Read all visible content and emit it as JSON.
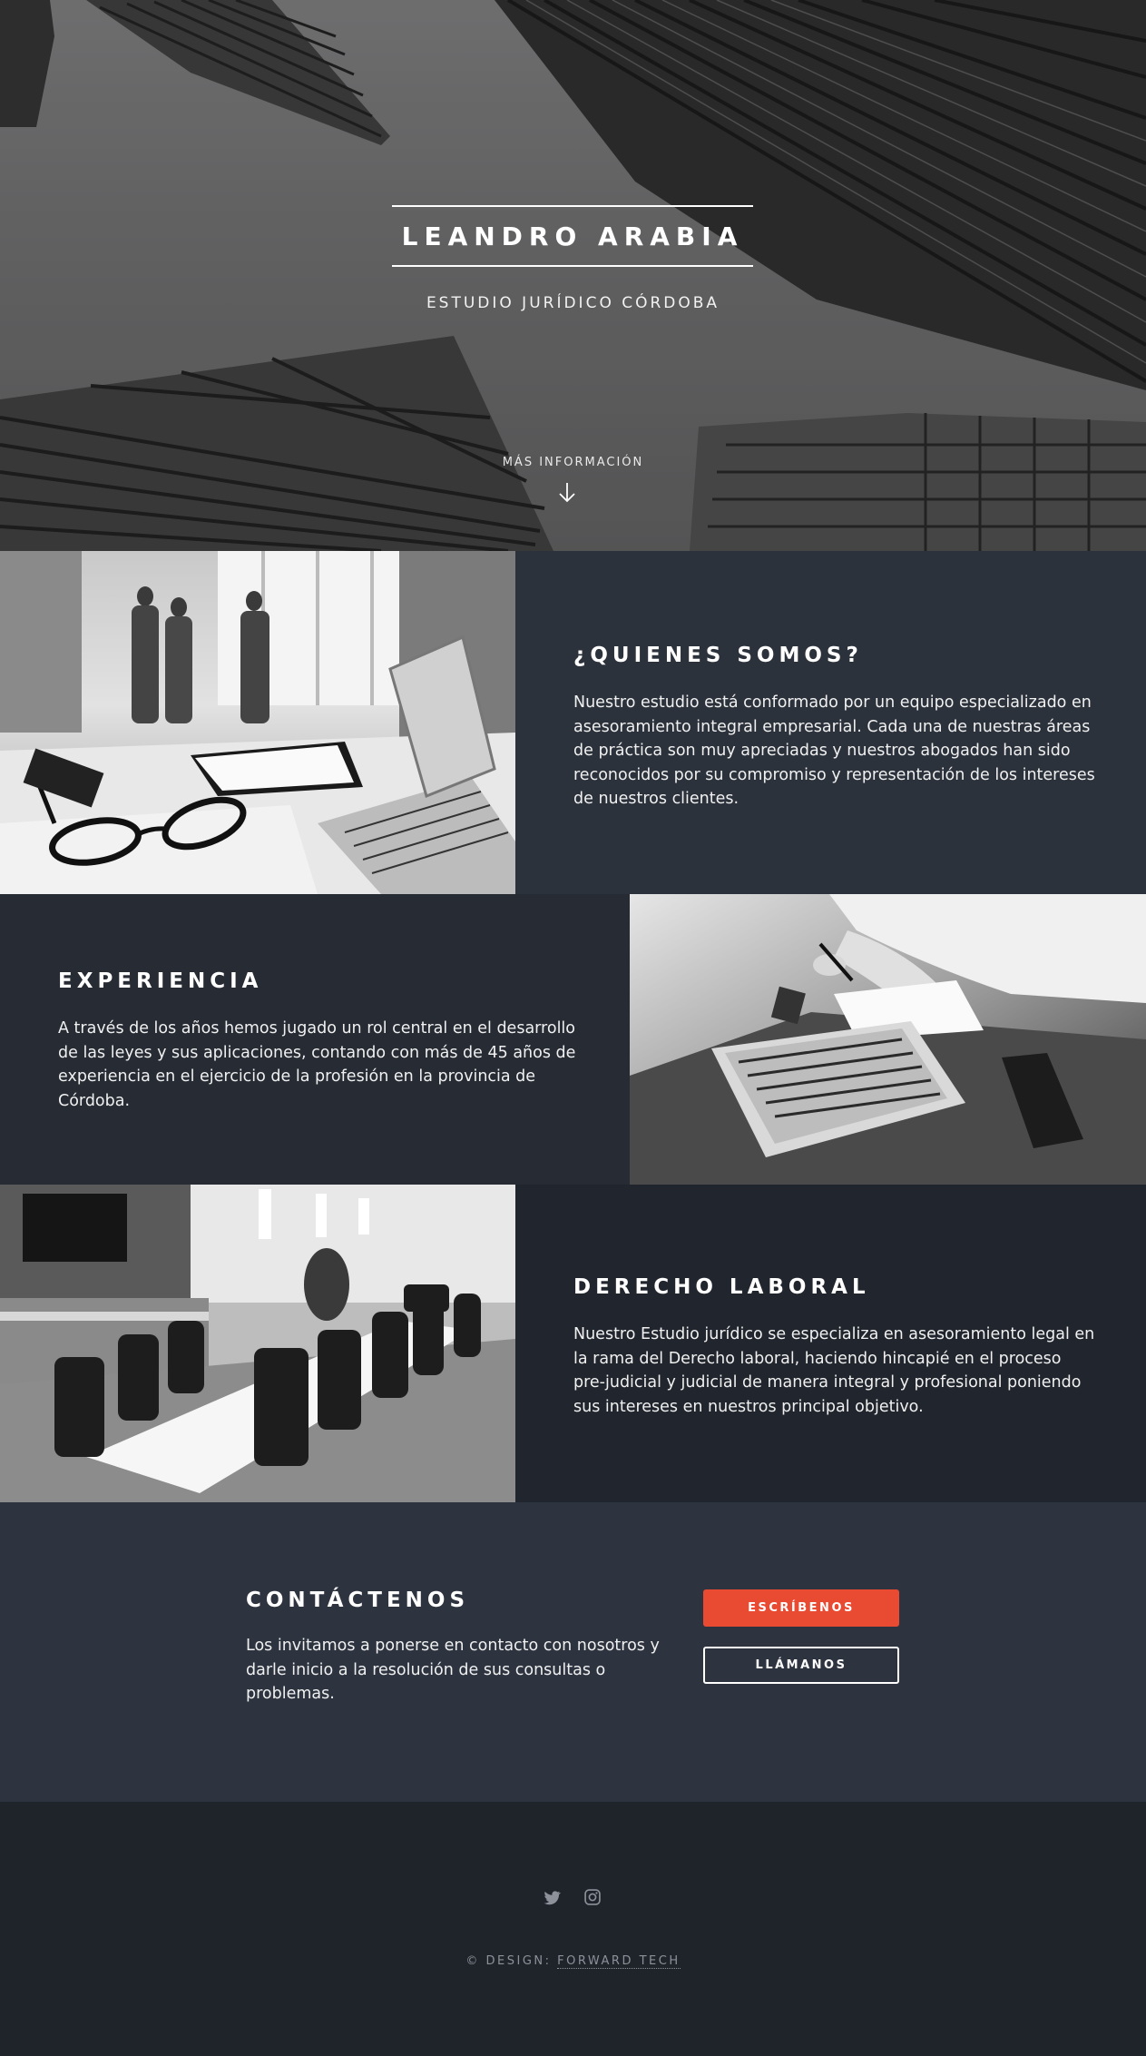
{
  "hero": {
    "title": "LEANDRO ARABIA",
    "subtitle": "ESTUDIO JURÍDICO CÓRDOBA",
    "more_label": "MÁS INFORMACIÓN",
    "more_icon": "arrow-down-icon"
  },
  "sections": [
    {
      "title": "¿QUIENES SOMOS?",
      "text": "Nuestro estudio está conformado por un equipo especializado en asesoramiento integral empresarial. Cada una de nuestras áreas de práctica son muy apreciadas y nuestros abogados han sido reconocidos por su compromiso y representación de los intereses de nuestros clientes."
    },
    {
      "title": "EXPERIENCIA",
      "text": "A través de los años hemos jugado un rol central en el desarrollo de las leyes y sus aplicaciones, contando con más de 45 años de experiencia en el ejercicio de la profesión en la provincia de Córdoba."
    },
    {
      "title": "DERECHO LABORAL",
      "text": "Nuestro Estudio jurídico se especializa en asesoramiento legal en la rama del Derecho laboral, haciendo hincapié en el proceso pre-judicial y judicial de manera integral y profesional poniendo sus intereses en nuestros principal objetivo."
    }
  ],
  "cta": {
    "title": "CONTÁCTENOS",
    "text": "Los invitamos a ponerse en contacto con nosotros y darle inicio a la resolución de sus consultas o problemas.",
    "primary_button": "ESCRÍBENOS",
    "secondary_button": "LLÁMANOS"
  },
  "footer": {
    "social_icons": [
      "twitter-icon",
      "instagram-icon"
    ],
    "credit_prefix": "© DESIGN: ",
    "credit_link": "FORWARD TECH"
  },
  "colors": {
    "accent": "#e84a32",
    "section_dark_1": "#2c323c",
    "section_dark_2": "#262b34",
    "section_dark_3": "#21252d",
    "cta_bg": "#2d3440",
    "footer_bg": "#1f232a"
  }
}
